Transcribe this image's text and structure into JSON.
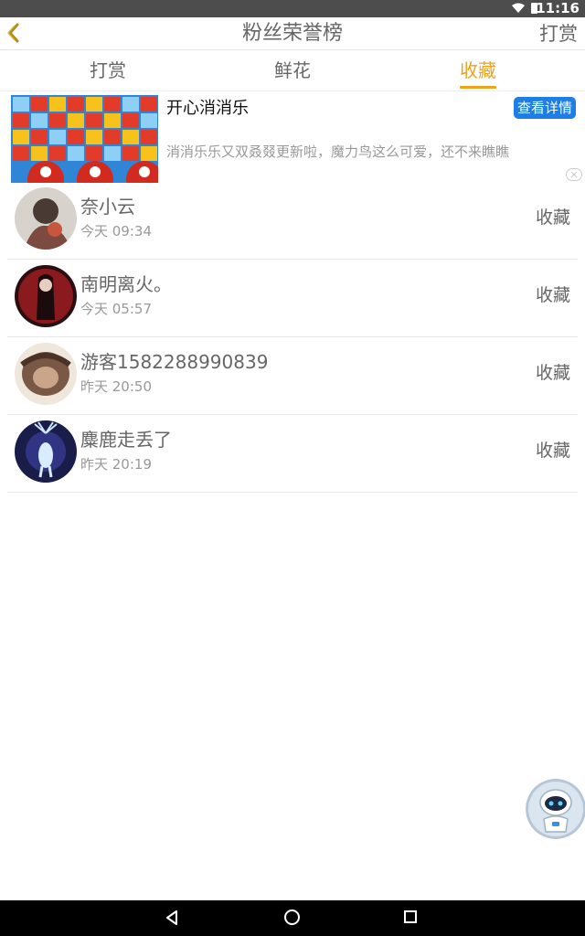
{
  "status_bar": {
    "time": "11:16",
    "icons": [
      "wifi-icon",
      "battery-icon"
    ]
  },
  "header": {
    "back_icon": "chevron-left-icon",
    "title": "粉丝荣誉榜",
    "action_label": "打赏"
  },
  "tabs": [
    {
      "label": "打赏",
      "active": false
    },
    {
      "label": "鲜花",
      "active": false
    },
    {
      "label": "收藏",
      "active": true
    }
  ],
  "ad": {
    "title": "开心消消乐",
    "description": "消消乐乐又双叒叕更新啦，魔力鸟这么可爱，还不来瞧瞧",
    "button_label": "查看详情",
    "close_icon": "ad-close-icon"
  },
  "fans": [
    {
      "name": "奈小云",
      "time": "今天 09:34",
      "gift": "收藏"
    },
    {
      "name": "南明离火。",
      "time": "今天 05:57",
      "gift": "收藏"
    },
    {
      "name": "游客1582288990839",
      "time": "昨天 20:50",
      "gift": "收藏"
    },
    {
      "name": "麋鹿走丢了",
      "time": "昨天 20:19",
      "gift": "收藏"
    }
  ],
  "floating_button": {
    "icon": "robot-assistant-icon"
  },
  "navigation_bar": {
    "icons": [
      "back-triangle-icon",
      "home-circle-icon",
      "recents-square-icon"
    ]
  },
  "colors": {
    "accent": "#f0a21c",
    "ad_button": "#1e7ee6",
    "status_bar": "#4d4d4d",
    "text_primary": "#666666",
    "text_secondary": "#999999"
  }
}
